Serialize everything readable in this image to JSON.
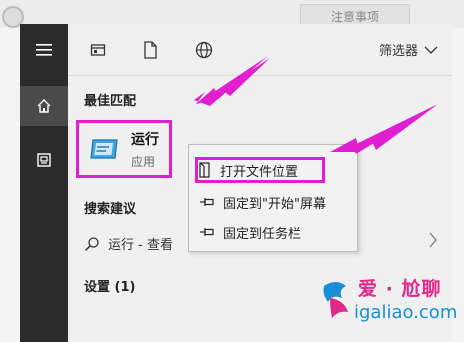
{
  "background": {
    "tab_text": "注意事项"
  },
  "rail": {
    "items": [
      {
        "icon": "hamburger-menu-icon"
      },
      {
        "icon": "home-icon",
        "active": true
      },
      {
        "icon": "document-box-icon"
      }
    ]
  },
  "toolbar": {
    "icons": [
      "apps-icon",
      "document-icon",
      "web-globe-icon"
    ],
    "filter_label": "筛选器"
  },
  "best_match": {
    "heading": "最佳匹配",
    "title": "运行",
    "subtitle": "应用"
  },
  "suggestions": {
    "heading": "搜索建议",
    "item_text": "运行 - 查看"
  },
  "settings": {
    "heading": "设置 (1)"
  },
  "context_menu": {
    "items": [
      {
        "label": "打开文件位置",
        "icon": "open-folder-icon"
      },
      {
        "label": "固定到\"开始\"屏幕",
        "icon": "pin-icon"
      },
      {
        "label": "固定到任务栏",
        "icon": "pin-icon"
      }
    ]
  },
  "watermark": {
    "title": "爱 · 尬聊",
    "url": "igaliao.com"
  },
  "colors": {
    "highlight": "#e020d0",
    "rail": "#2b2b2b",
    "watermark_pink": "#e0298a",
    "watermark_blue": "#1b8fd6"
  }
}
